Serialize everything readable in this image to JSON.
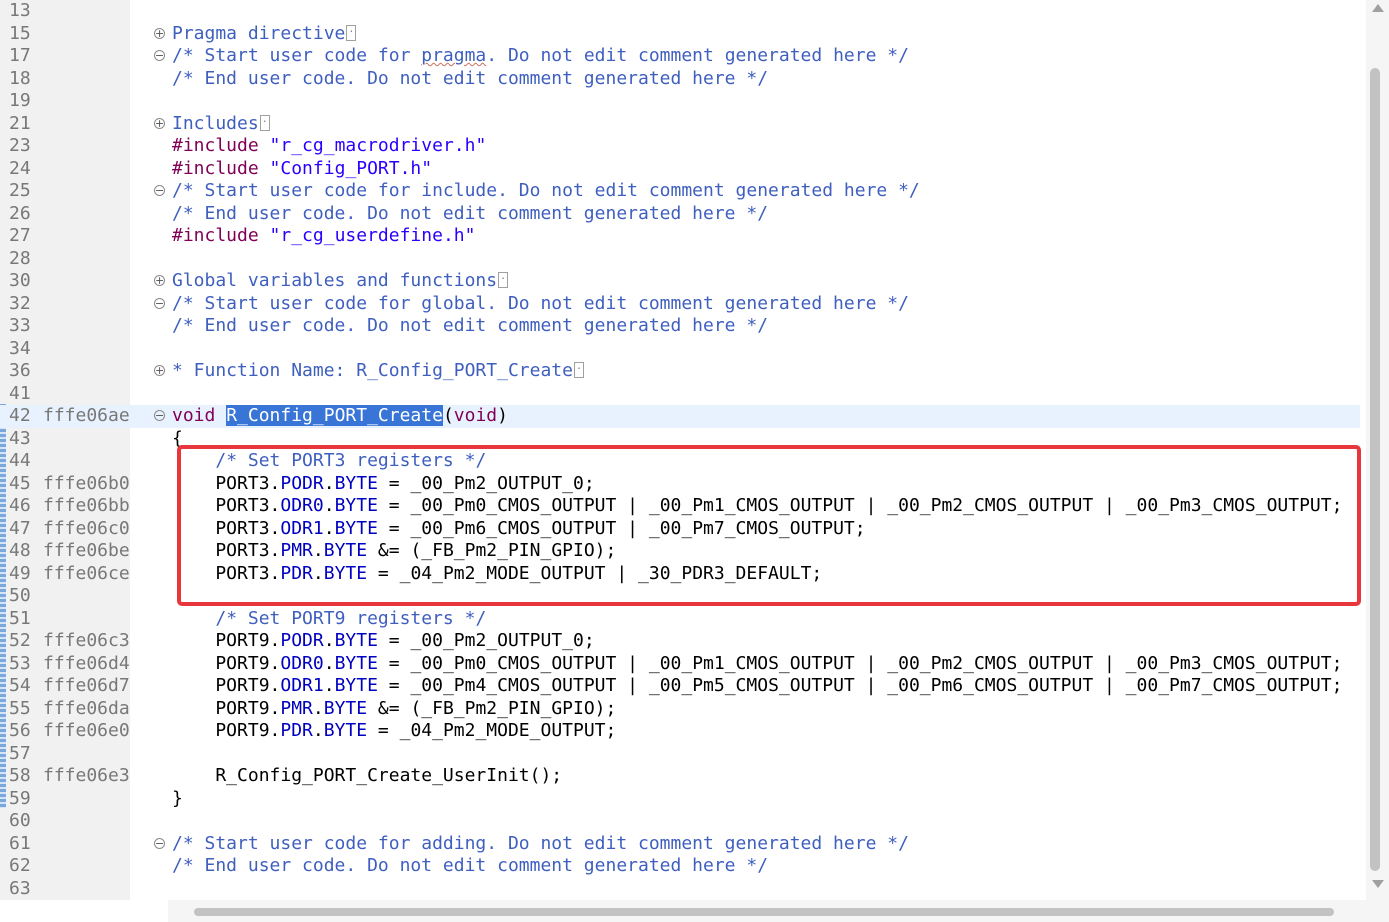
{
  "editor": {
    "lines": [
      {
        "num": "13",
        "addr": "",
        "fold": "",
        "code": []
      },
      {
        "num": "15",
        "addr": "",
        "fold": "plus",
        "code": [
          {
            "t": "Pragma directive",
            "c": "fold-title-pragma"
          }
        ],
        "more": true
      },
      {
        "num": "17",
        "addr": "",
        "fold": "minus",
        "code": [
          {
            "t": "/* Start user code for ",
            "c": "comment"
          },
          {
            "t": "pragma",
            "c": "comment squig"
          },
          {
            "t": ". Do not edit comment generated here */",
            "c": "comment"
          }
        ]
      },
      {
        "num": "18",
        "addr": "",
        "fold": "",
        "code": [
          {
            "t": "/* End user code. Do not edit comment generated here */",
            "c": "comment"
          }
        ]
      },
      {
        "num": "19",
        "addr": "",
        "fold": "",
        "code": []
      },
      {
        "num": "21",
        "addr": "",
        "fold": "plus",
        "code": [
          {
            "t": "Includes",
            "c": "fold-title"
          }
        ],
        "more": true
      },
      {
        "num": "23",
        "addr": "",
        "fold": "",
        "code": [
          {
            "t": "#include",
            "c": "kw"
          },
          {
            "t": " ",
            "c": ""
          },
          {
            "t": "\"r_cg_macrodriver.h\"",
            "c": "str"
          }
        ]
      },
      {
        "num": "24",
        "addr": "",
        "fold": "",
        "code": [
          {
            "t": "#include",
            "c": "kw"
          },
          {
            "t": " ",
            "c": ""
          },
          {
            "t": "\"Config_PORT.h\"",
            "c": "str"
          }
        ]
      },
      {
        "num": "25",
        "addr": "",
        "fold": "minus",
        "code": [
          {
            "t": "/* Start user code for include. Do not edit comment generated here */",
            "c": "comment"
          }
        ]
      },
      {
        "num": "26",
        "addr": "",
        "fold": "",
        "code": [
          {
            "t": "/* End user code. Do not edit comment generated here */",
            "c": "comment"
          }
        ]
      },
      {
        "num": "27",
        "addr": "",
        "fold": "",
        "code": [
          {
            "t": "#include",
            "c": "kw"
          },
          {
            "t": " ",
            "c": ""
          },
          {
            "t": "\"r_cg_userdefine.h\"",
            "c": "str"
          }
        ]
      },
      {
        "num": "28",
        "addr": "",
        "fold": "",
        "code": []
      },
      {
        "num": "30",
        "addr": "",
        "fold": "plus",
        "code": [
          {
            "t": "Global variables and functions",
            "c": "fold-title"
          }
        ],
        "more": true
      },
      {
        "num": "32",
        "addr": "",
        "fold": "minus",
        "code": [
          {
            "t": "/* Start user code for global. Do not edit comment generated here */",
            "c": "comment"
          }
        ]
      },
      {
        "num": "33",
        "addr": "",
        "fold": "",
        "code": [
          {
            "t": "/* End user code. Do not edit comment generated here */",
            "c": "comment"
          }
        ]
      },
      {
        "num": "34",
        "addr": "",
        "fold": "",
        "code": []
      },
      {
        "num": "36",
        "addr": "",
        "fold": "plus",
        "code": [
          {
            "t": "* Function Name: R_Config_PORT_Create",
            "c": "fold-title"
          }
        ],
        "more": true
      },
      {
        "num": "41",
        "addr": "",
        "fold": "",
        "code": []
      },
      {
        "num": "42",
        "addr": "fffe06ae",
        "fold": "minus",
        "current": true,
        "code": [
          {
            "t": "void",
            "c": "kw"
          },
          {
            "t": " ",
            "c": ""
          },
          {
            "t": "R_Config_PORT_Create",
            "c": "sel"
          },
          {
            "t": "(",
            "c": ""
          },
          {
            "t": "void",
            "c": "kw"
          },
          {
            "t": ")",
            "c": ""
          }
        ]
      },
      {
        "num": "43",
        "addr": "",
        "fold": "",
        "code": [
          {
            "t": "{",
            "c": ""
          }
        ]
      },
      {
        "num": "44",
        "addr": "",
        "fold": "",
        "code": [
          {
            "t": "    ",
            "c": ""
          },
          {
            "t": "/* Set PORT3 registers */",
            "c": "comment"
          }
        ]
      },
      {
        "num": "45",
        "addr": "fffe06b0",
        "fold": "",
        "code": [
          {
            "t": "    PORT3.",
            "c": ""
          },
          {
            "t": "PODR",
            "c": "field"
          },
          {
            "t": ".",
            "c": ""
          },
          {
            "t": "BYTE",
            "c": "field"
          },
          {
            "t": " = _00_Pm2_OUTPUT_0;",
            "c": ""
          }
        ]
      },
      {
        "num": "46",
        "addr": "fffe06bb",
        "fold": "",
        "code": [
          {
            "t": "    PORT3.",
            "c": ""
          },
          {
            "t": "ODR0",
            "c": "field"
          },
          {
            "t": ".",
            "c": ""
          },
          {
            "t": "BYTE",
            "c": "field"
          },
          {
            "t": " = _00_Pm0_CMOS_OUTPUT | _00_Pm1_CMOS_OUTPUT | _00_Pm2_CMOS_OUTPUT | _00_Pm3_CMOS_OUTPUT;",
            "c": ""
          }
        ]
      },
      {
        "num": "47",
        "addr": "fffe06c0",
        "fold": "",
        "code": [
          {
            "t": "    PORT3.",
            "c": ""
          },
          {
            "t": "ODR1",
            "c": "field"
          },
          {
            "t": ".",
            "c": ""
          },
          {
            "t": "BYTE",
            "c": "field"
          },
          {
            "t": " = _00_Pm6_CMOS_OUTPUT | _00_Pm7_CMOS_OUTPUT;",
            "c": ""
          }
        ]
      },
      {
        "num": "48",
        "addr": "fffe06be",
        "fold": "",
        "code": [
          {
            "t": "    PORT3.",
            "c": ""
          },
          {
            "t": "PMR",
            "c": "field"
          },
          {
            "t": ".",
            "c": ""
          },
          {
            "t": "BYTE",
            "c": "field"
          },
          {
            "t": " &= (_FB_Pm2_PIN_GPIO);",
            "c": ""
          }
        ]
      },
      {
        "num": "49",
        "addr": "fffe06ce",
        "fold": "",
        "code": [
          {
            "t": "    PORT3.",
            "c": ""
          },
          {
            "t": "PDR",
            "c": "field"
          },
          {
            "t": ".",
            "c": ""
          },
          {
            "t": "BYTE",
            "c": "field"
          },
          {
            "t": " = _04_Pm2_MODE_OUTPUT | _30_PDR3_DEFAULT;",
            "c": ""
          }
        ]
      },
      {
        "num": "50",
        "addr": "",
        "fold": "",
        "code": []
      },
      {
        "num": "51",
        "addr": "",
        "fold": "",
        "code": [
          {
            "t": "    ",
            "c": ""
          },
          {
            "t": "/* Set PORT9 registers */",
            "c": "comment"
          }
        ]
      },
      {
        "num": "52",
        "addr": "fffe06c3",
        "fold": "",
        "code": [
          {
            "t": "    PORT9.",
            "c": ""
          },
          {
            "t": "PODR",
            "c": "field"
          },
          {
            "t": ".",
            "c": ""
          },
          {
            "t": "BYTE",
            "c": "field"
          },
          {
            "t": " = _00_Pm2_OUTPUT_0;",
            "c": ""
          }
        ]
      },
      {
        "num": "53",
        "addr": "fffe06d4",
        "fold": "",
        "code": [
          {
            "t": "    PORT9.",
            "c": ""
          },
          {
            "t": "ODR0",
            "c": "field"
          },
          {
            "t": ".",
            "c": ""
          },
          {
            "t": "BYTE",
            "c": "field"
          },
          {
            "t": " = _00_Pm0_CMOS_OUTPUT | _00_Pm1_CMOS_OUTPUT | _00_Pm2_CMOS_OUTPUT | _00_Pm3_CMOS_OUTPUT;",
            "c": ""
          }
        ]
      },
      {
        "num": "54",
        "addr": "fffe06d7",
        "fold": "",
        "code": [
          {
            "t": "    PORT9.",
            "c": ""
          },
          {
            "t": "ODR1",
            "c": "field"
          },
          {
            "t": ".",
            "c": ""
          },
          {
            "t": "BYTE",
            "c": "field"
          },
          {
            "t": " = _00_Pm4_CMOS_OUTPUT | _00_Pm5_CMOS_OUTPUT | _00_Pm6_CMOS_OUTPUT | _00_Pm7_CMOS_OUTPUT;",
            "c": ""
          }
        ]
      },
      {
        "num": "55",
        "addr": "fffe06da",
        "fold": "",
        "code": [
          {
            "t": "    PORT9.",
            "c": ""
          },
          {
            "t": "PMR",
            "c": "field"
          },
          {
            "t": ".",
            "c": ""
          },
          {
            "t": "BYTE",
            "c": "field"
          },
          {
            "t": " &= (_FB_Pm2_PIN_GPIO);",
            "c": ""
          }
        ]
      },
      {
        "num": "56",
        "addr": "fffe06e0",
        "fold": "",
        "code": [
          {
            "t": "    PORT9.",
            "c": ""
          },
          {
            "t": "PDR",
            "c": "field"
          },
          {
            "t": ".",
            "c": ""
          },
          {
            "t": "BYTE",
            "c": "field"
          },
          {
            "t": " = _04_Pm2_MODE_OUTPUT;",
            "c": ""
          }
        ]
      },
      {
        "num": "57",
        "addr": "",
        "fold": "",
        "code": []
      },
      {
        "num": "58",
        "addr": "fffe06e3",
        "fold": "",
        "code": [
          {
            "t": "    R_Config_PORT_Create_UserInit();",
            "c": ""
          }
        ]
      },
      {
        "num": "59",
        "addr": "",
        "fold": "",
        "code": [
          {
            "t": "}",
            "c": ""
          }
        ]
      },
      {
        "num": "60",
        "addr": "",
        "fold": "",
        "code": []
      },
      {
        "num": "61",
        "addr": "",
        "fold": "minus",
        "code": [
          {
            "t": "/* Start user code for adding. Do not edit comment generated here */",
            "c": "comment"
          }
        ]
      },
      {
        "num": "62",
        "addr": "",
        "fold": "",
        "code": [
          {
            "t": "/* End user code. Do not edit comment generated here */",
            "c": "comment"
          }
        ]
      },
      {
        "num": "63",
        "addr": "",
        "fold": "",
        "code": []
      }
    ]
  },
  "colors": {
    "highlight_box": "#e8363d",
    "selection": "#3875d7",
    "current_line": "#e8f2fe"
  },
  "icons": {
    "fold_expand": "plus-circle-icon",
    "fold_collapse": "minus-circle-icon"
  }
}
